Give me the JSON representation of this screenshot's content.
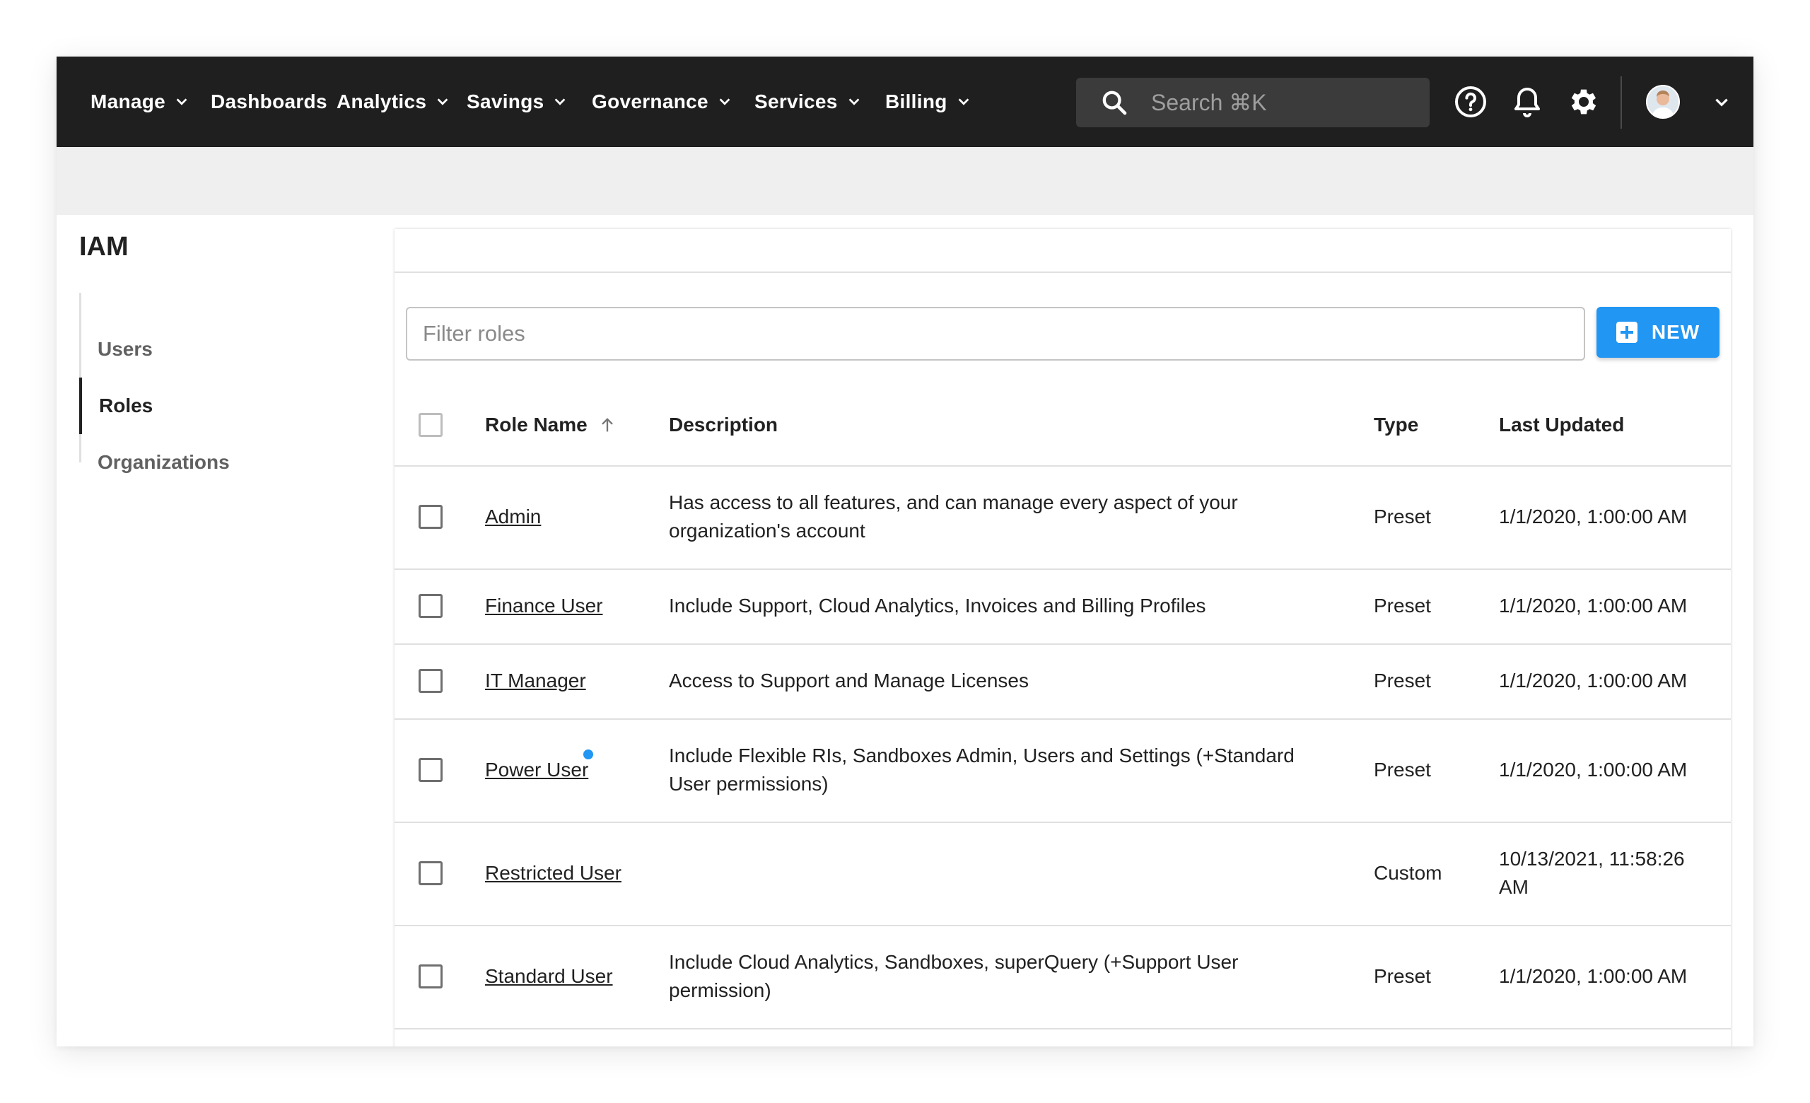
{
  "nav": {
    "items": [
      {
        "label": "Manage",
        "has_dropdown": true
      },
      {
        "label": "Dashboards",
        "has_dropdown": false
      },
      {
        "label": "Analytics",
        "has_dropdown": true
      },
      {
        "label": "Savings",
        "has_dropdown": true
      },
      {
        "label": "Governance",
        "has_dropdown": true
      },
      {
        "label": "Services",
        "has_dropdown": true
      },
      {
        "label": "Billing",
        "has_dropdown": true
      }
    ],
    "search_placeholder": "Search ⌘K",
    "icons": [
      "help-icon",
      "bell-icon",
      "gear-icon",
      "avatar",
      "chevron-down-icon"
    ]
  },
  "sidebar": {
    "title": "IAM",
    "items": [
      {
        "label": "Users",
        "active": false
      },
      {
        "label": "Roles",
        "active": true
      },
      {
        "label": "Organizations",
        "active": false
      }
    ]
  },
  "main": {
    "filter_placeholder": "Filter roles",
    "new_button_label": "NEW",
    "columns": {
      "name": "Role Name",
      "description": "Description",
      "type": "Type",
      "updated": "Last Updated"
    },
    "sort": "Role Name ascending",
    "rows": [
      {
        "name": "Admin",
        "description": "Has access to all features, and can manage every aspect of your organization's account",
        "type": "Preset",
        "updated": "1/1/2020, 1:00:00 AM",
        "dot": false
      },
      {
        "name": "Finance User",
        "description": "Include Support, Cloud Analytics, Invoices and Billing Profiles",
        "type": "Preset",
        "updated": "1/1/2020, 1:00:00 AM",
        "dot": false
      },
      {
        "name": "IT Manager",
        "description": "Access to Support and Manage Licenses",
        "type": "Preset",
        "updated": "1/1/2020, 1:00:00 AM",
        "dot": false
      },
      {
        "name": "Power User",
        "description": "Include Flexible RIs, Sandboxes Admin, Users and Settings (+Standard User permissions)",
        "type": "Preset",
        "updated": "1/1/2020, 1:00:00 AM",
        "dot": true
      },
      {
        "name": "Restricted User",
        "description": "",
        "type": "Custom",
        "updated": "10/13/2021, 11:58:26 AM",
        "dot": false
      },
      {
        "name": "Standard User",
        "description": "Include Cloud Analytics, Sandboxes, superQuery (+Support User permission)",
        "type": "Preset",
        "updated": "1/1/2020, 1:00:00 AM",
        "dot": false
      }
    ]
  },
  "colors": {
    "nav_bg": "#1f1f1f",
    "accent": "#2196f3",
    "band": "#efefef"
  }
}
